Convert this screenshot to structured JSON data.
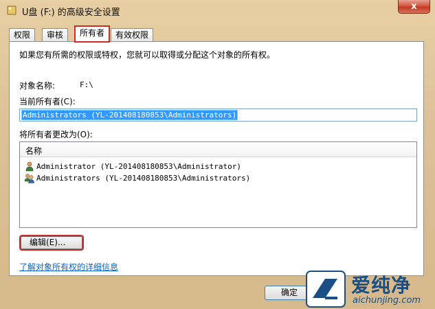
{
  "window": {
    "title": "U盘 (F:) 的高级安全设置",
    "close_label": "x"
  },
  "tabs": [
    {
      "label": "权限",
      "active": false
    },
    {
      "label": "审核",
      "active": false
    },
    {
      "label": "所有者",
      "active": true
    },
    {
      "label": "有效权限",
      "active": false
    }
  ],
  "owner_tab": {
    "intro": "如果您有所需的权限或特权，您就可以取得或分配这个对象的所有权。",
    "object_name_label": "对象名称:",
    "object_name_value": "F:\\",
    "current_owner_label": "当前所有者(C):",
    "current_owner_value": "Administrators (YL-201408180853\\Administrators)",
    "change_owner_label": "将所有者更改为(O):",
    "list_header": "名称",
    "owners": [
      {
        "name": "Administrator (YL-201408180853\\Administrator)",
        "icon": "user-icon"
      },
      {
        "name": "Administrators (YL-201408180853\\Administrators)",
        "icon": "group-icon"
      }
    ],
    "edit_button": "编辑(E)...",
    "learn_more_link": "了解对象所有权的详细信息"
  },
  "footer": {
    "ok_button": "确定"
  },
  "watermark": {
    "brand_cn": "爱纯净",
    "brand_url": "aichunjing.com"
  },
  "colors": {
    "selection": "#3399ff",
    "highlight_outline": "#cc2a2a",
    "link": "#0a64c8"
  }
}
